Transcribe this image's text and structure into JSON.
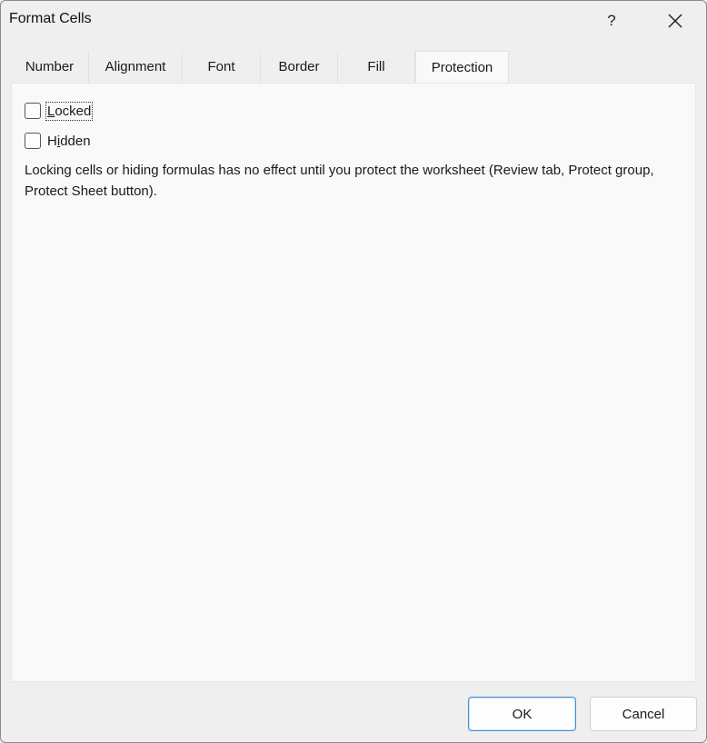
{
  "dialog": {
    "title": "Format Cells",
    "help_label": "?"
  },
  "tabs": [
    {
      "label": "Number",
      "active": false
    },
    {
      "label": "Alignment",
      "active": false
    },
    {
      "label": "Font",
      "active": false
    },
    {
      "label": "Border",
      "active": false
    },
    {
      "label": "Fill",
      "active": false
    },
    {
      "label": "Protection",
      "active": true
    }
  ],
  "protection": {
    "locked": {
      "label_prefix": "",
      "access_key": "L",
      "label_rest": "ocked",
      "checked": false
    },
    "hidden": {
      "label_prefix": "H",
      "access_key": "i",
      "label_rest": "dden",
      "checked": false
    },
    "note": "Locking cells or hiding formulas has no effect until you protect the worksheet (Review tab, Protect group, Protect Sheet button)."
  },
  "buttons": {
    "ok": "OK",
    "cancel": "Cancel"
  },
  "colors": {
    "accent": "#3f8fd6",
    "panel_bg": "#f9f9f9",
    "dialog_bg": "#efefef"
  },
  "icons": {
    "close": "close-icon"
  }
}
